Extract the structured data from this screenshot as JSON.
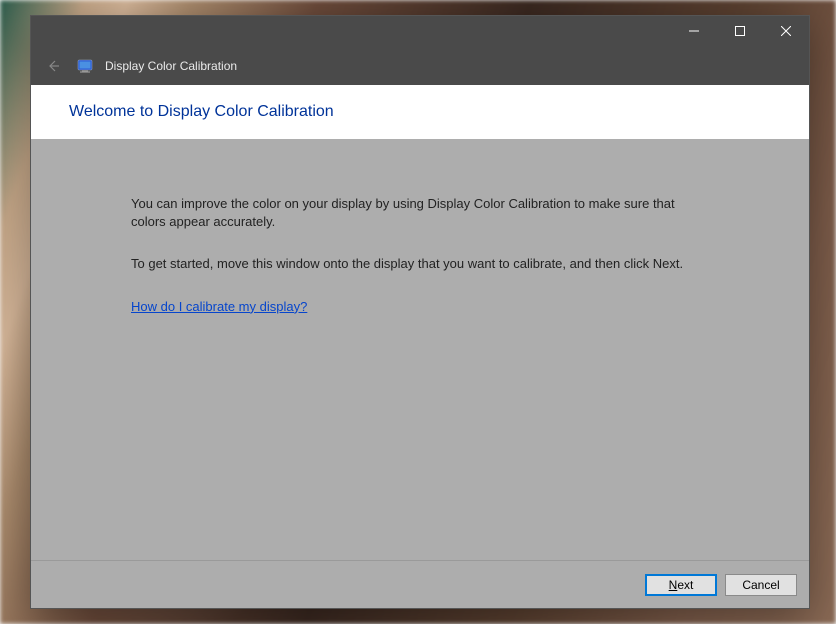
{
  "titlebar": {
    "minimize_tooltip": "Minimize",
    "maximize_tooltip": "Maximize",
    "close_tooltip": "Close"
  },
  "header": {
    "back_tooltip": "Back",
    "app_title": "Display Color Calibration"
  },
  "page": {
    "title": "Welcome to Display Color Calibration"
  },
  "content": {
    "paragraph1": "You can improve the color on your display by using Display Color Calibration to make sure that colors appear accurately.",
    "paragraph2": "To get started, move this window onto the display that you want to calibrate, and then click Next.",
    "help_link": "How do I calibrate my display?"
  },
  "footer": {
    "next_accel": "N",
    "next_rest": "ext",
    "cancel_label": "Cancel"
  }
}
